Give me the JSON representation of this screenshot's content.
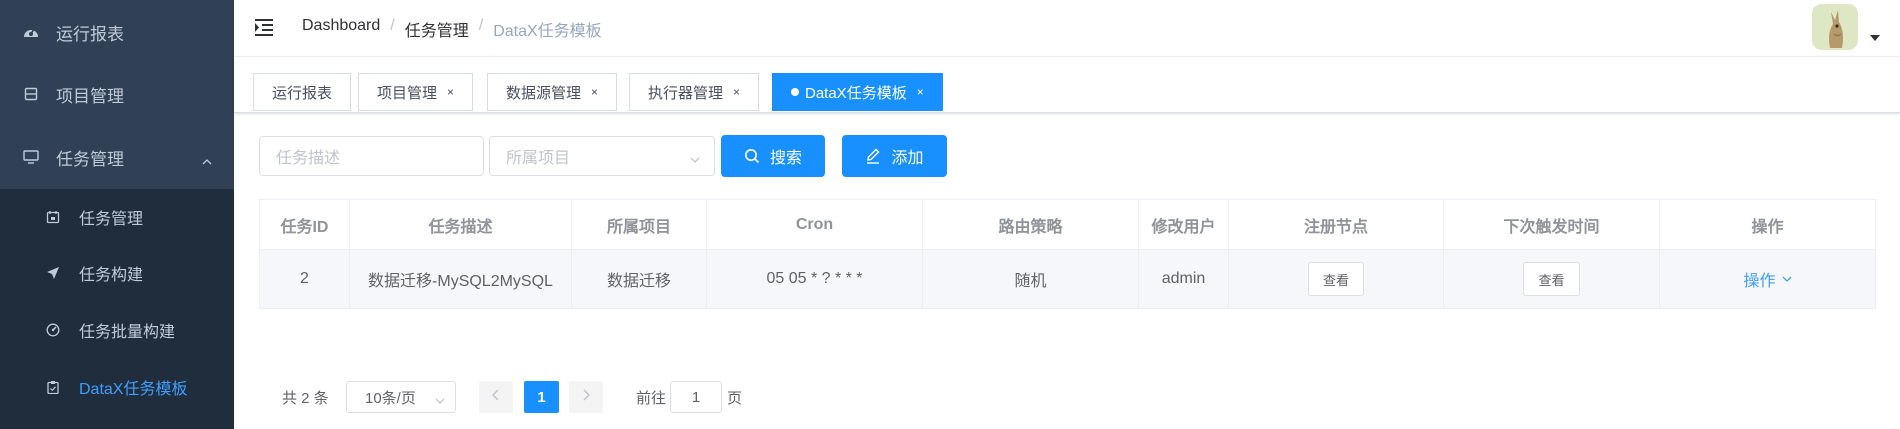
{
  "sidebar": {
    "items": [
      {
        "label": "运行报表",
        "icon": "dashboard-icon"
      },
      {
        "label": "项目管理",
        "icon": "project-icon"
      },
      {
        "label": "任务管理",
        "icon": "monitor-icon",
        "expanded": true
      }
    ],
    "submenu": [
      {
        "label": "任务管理",
        "icon": "task-icon"
      },
      {
        "label": "任务构建",
        "icon": "send-icon"
      },
      {
        "label": "任务批量构建",
        "icon": "gauge-icon"
      },
      {
        "label": "DataX任务模板",
        "icon": "clipboard-icon",
        "active": true
      }
    ]
  },
  "breadcrumb": {
    "items": [
      "Dashboard",
      "任务管理",
      "DataX任务模板"
    ],
    "separator": "/"
  },
  "tags": [
    {
      "label": "运行报表",
      "closable": false
    },
    {
      "label": "项目管理",
      "closable": true
    },
    {
      "label": "数据源管理",
      "closable": true
    },
    {
      "label": "执行器管理",
      "closable": true
    },
    {
      "label": "DataX任务模板",
      "closable": true,
      "active": true
    }
  ],
  "tag_close_glyph": "×",
  "filters": {
    "desc_placeholder": "任务描述",
    "project_placeholder": "所属项目",
    "search_label": "搜索",
    "add_label": "添加"
  },
  "table": {
    "headers": [
      "任务ID",
      "任务描述",
      "所属项目",
      "Cron",
      "路由策略",
      "修改用户",
      "注册节点",
      "下次触发时间",
      "操作"
    ],
    "rows": [
      {
        "id": "2",
        "desc": "数据迁移-MySQL2MySQL",
        "project": "数据迁移",
        "cron": "05 05 * ? * * *",
        "route": "随机",
        "user": "admin",
        "node_btn": "查看",
        "trigger_btn": "查看",
        "op": "操作"
      }
    ]
  },
  "pagination": {
    "total": "共 2 条",
    "page_size": "10条/页",
    "current": "1",
    "goto_label": "前往",
    "goto_value": "1",
    "page_suffix": "页"
  },
  "colors": {
    "sidebar_bg": "#304156",
    "submenu_bg": "#1f2d3d",
    "primary": "#1890ff",
    "active_text": "#409eff"
  }
}
